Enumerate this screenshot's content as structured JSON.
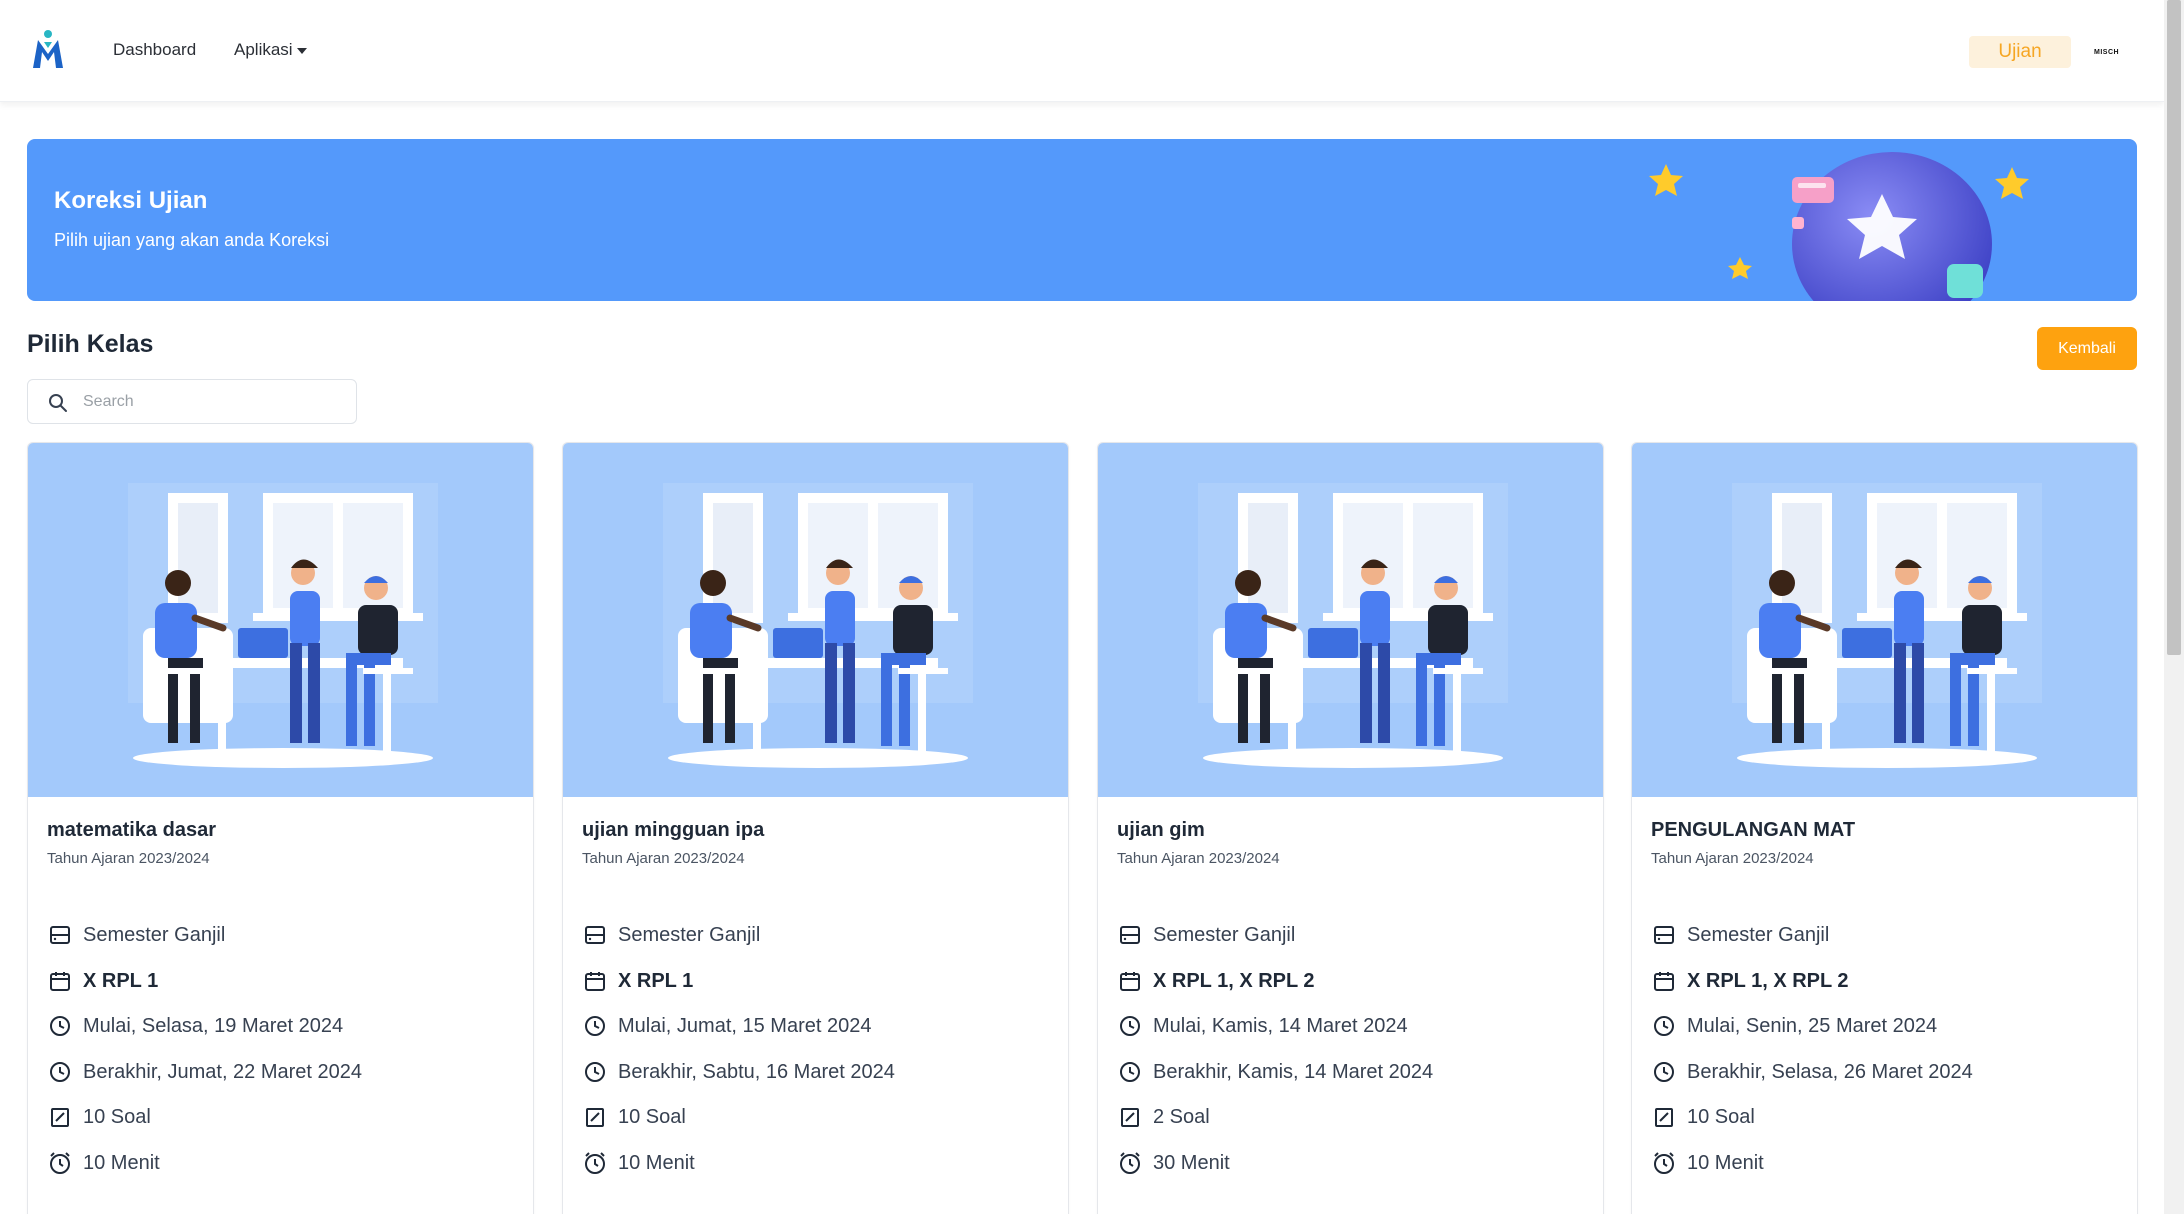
{
  "navbar": {
    "links": [
      {
        "label": "Dashboard"
      },
      {
        "label": "Aplikasi"
      }
    ],
    "badge": "Ujian",
    "user_brand": "MISCH",
    "accent_color": "#f6a623"
  },
  "banner": {
    "title": "Koreksi Ujian",
    "subtitle": "Pilih ujian yang akan anda Koreksi",
    "background": "#5499fb"
  },
  "section": {
    "title": "Pilih Kelas",
    "back_button": "Kembali"
  },
  "search": {
    "placeholder": "Search",
    "value": ""
  },
  "cards": [
    {
      "title": "matematika dasar",
      "year": "Tahun Ajaran 2023/2024",
      "semester": "Semester Ganjil",
      "classes": "X RPL 1",
      "start": "Mulai, Selasa, 19 Maret 2024",
      "end": "Berakhir, Jumat, 22 Maret 2024",
      "questions": "10 Soal",
      "duration": "10 Menit"
    },
    {
      "title": "ujian mingguan ipa",
      "year": "Tahun Ajaran 2023/2024",
      "semester": "Semester Ganjil",
      "classes": "X RPL 1",
      "start": "Mulai, Jumat, 15 Maret 2024",
      "end": "Berakhir, Sabtu, 16 Maret 2024",
      "questions": "10 Soal",
      "duration": "10 Menit"
    },
    {
      "title": "ujian gim",
      "year": "Tahun Ajaran 2023/2024",
      "semester": "Semester Ganjil",
      "classes": "X RPL 1, X RPL 2",
      "start": "Mulai, Kamis, 14 Maret 2024",
      "end": "Berakhir, Kamis, 14 Maret 2024",
      "questions": "2 Soal",
      "duration": "30 Menit"
    },
    {
      "title": "PENGULANGAN MAT",
      "year": "Tahun Ajaran 2023/2024",
      "semester": "Semester Ganjil",
      "classes": "X RPL 1, X RPL 2",
      "start": "Mulai, Senin, 25 Maret 2024",
      "end": "Berakhir, Selasa, 26 Maret 2024",
      "questions": "10 Soal",
      "duration": "10 Menit"
    }
  ]
}
